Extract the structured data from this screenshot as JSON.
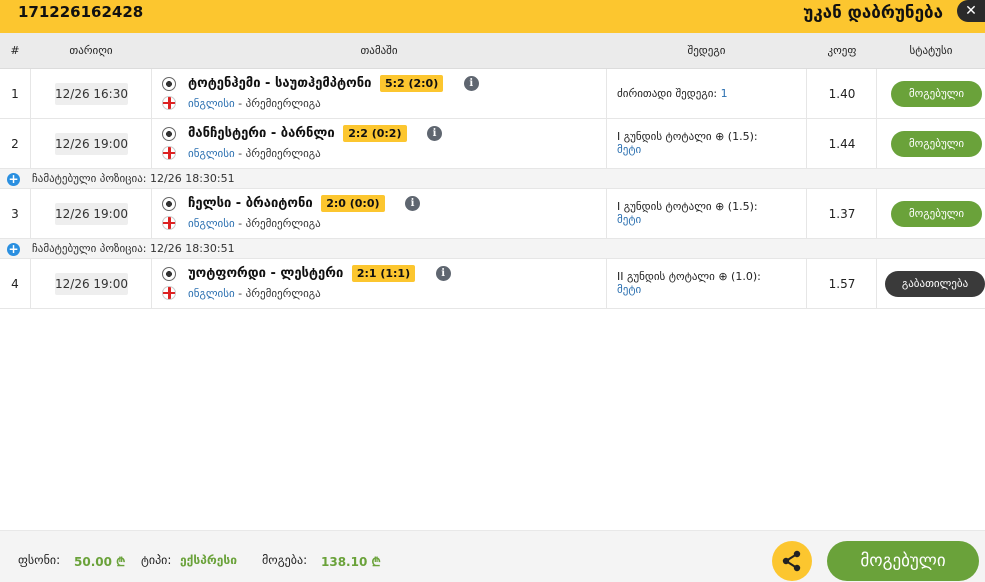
{
  "header": {
    "bet_id": "171226162428",
    "back_label": "უკან დაბრუნება",
    "close_icon": "close-icon"
  },
  "columns": {
    "num": "#",
    "date": "თარიღი",
    "game": "თამაში",
    "result": "შედეგი",
    "coef": "კოეფ",
    "status": "სტატუსი"
  },
  "rows": [
    {
      "num": "1",
      "date": "12/26 16:30",
      "match": "ტოტენჰემი - საუთჰემპტონი",
      "score": "5:2 (2:0)",
      "country": "ინგლისი",
      "league": " - პრემიერლიგა",
      "result_line1": "ძირითადი შედეგი: ",
      "result_highlight": "1",
      "result_line2": "",
      "coef": "1.40",
      "status": "მოგებული"
    },
    {
      "num": "2",
      "date": "12/26 19:00",
      "match": "მანჩესტერი - ბარნლი",
      "score": "2:2 (0:2)",
      "country": "ინგლისი",
      "league": " - პრემიერლიგა",
      "result_line1": "I გუნდის ტოტალი ⊕ (1.5):",
      "result_highlight": "",
      "result_line2": "მეტი",
      "coef": "1.44",
      "status": "მოგებული"
    },
    {
      "num": "3",
      "date": "12/26 19:00",
      "match": "ჩელსი - ბრაიტონი",
      "score": "2:0 (0:0)",
      "country": "ინგლისი",
      "league": " - პრემიერლიგა",
      "result_line1": "I გუნდის ტოტალი ⊕ (1.5):",
      "result_highlight": "",
      "result_line2": "მეტი",
      "coef": "1.37",
      "status": "მოგებული"
    },
    {
      "num": "4",
      "date": "12/26 19:00",
      "match": "უოტფორდი - ლესტერი",
      "score": "2:1 (1:1)",
      "country": "ინგლისი",
      "league": " - პრემიერლიგა",
      "result_line1": "II გუნდის ტოტალი ⊕ (1.0):",
      "result_highlight": "",
      "result_line2": "მეტი",
      "coef": "1.57",
      "status": "გაბათილება"
    }
  ],
  "added_positions": [
    {
      "label": "ჩამატებული პოზიცია:",
      "time": " 12/26 18:30:51"
    },
    {
      "label": "ჩამატებული პოზიცია:",
      "time": " 12/26 18:30:51"
    }
  ],
  "footer": {
    "stake_label": "ფსონი:",
    "stake_value": "50.00 ₾",
    "type_label": "ტიპი:",
    "type_value": "ექსპრესი",
    "win_label": "მოგება:",
    "win_value": "138.10 ₾",
    "won_button": "მოგებული"
  },
  "colors": {
    "accent_yellow": "#fcc62f",
    "won_green": "#6aa23a",
    "void_dark": "#3a3a3a",
    "link_blue": "#2a6fb0"
  }
}
